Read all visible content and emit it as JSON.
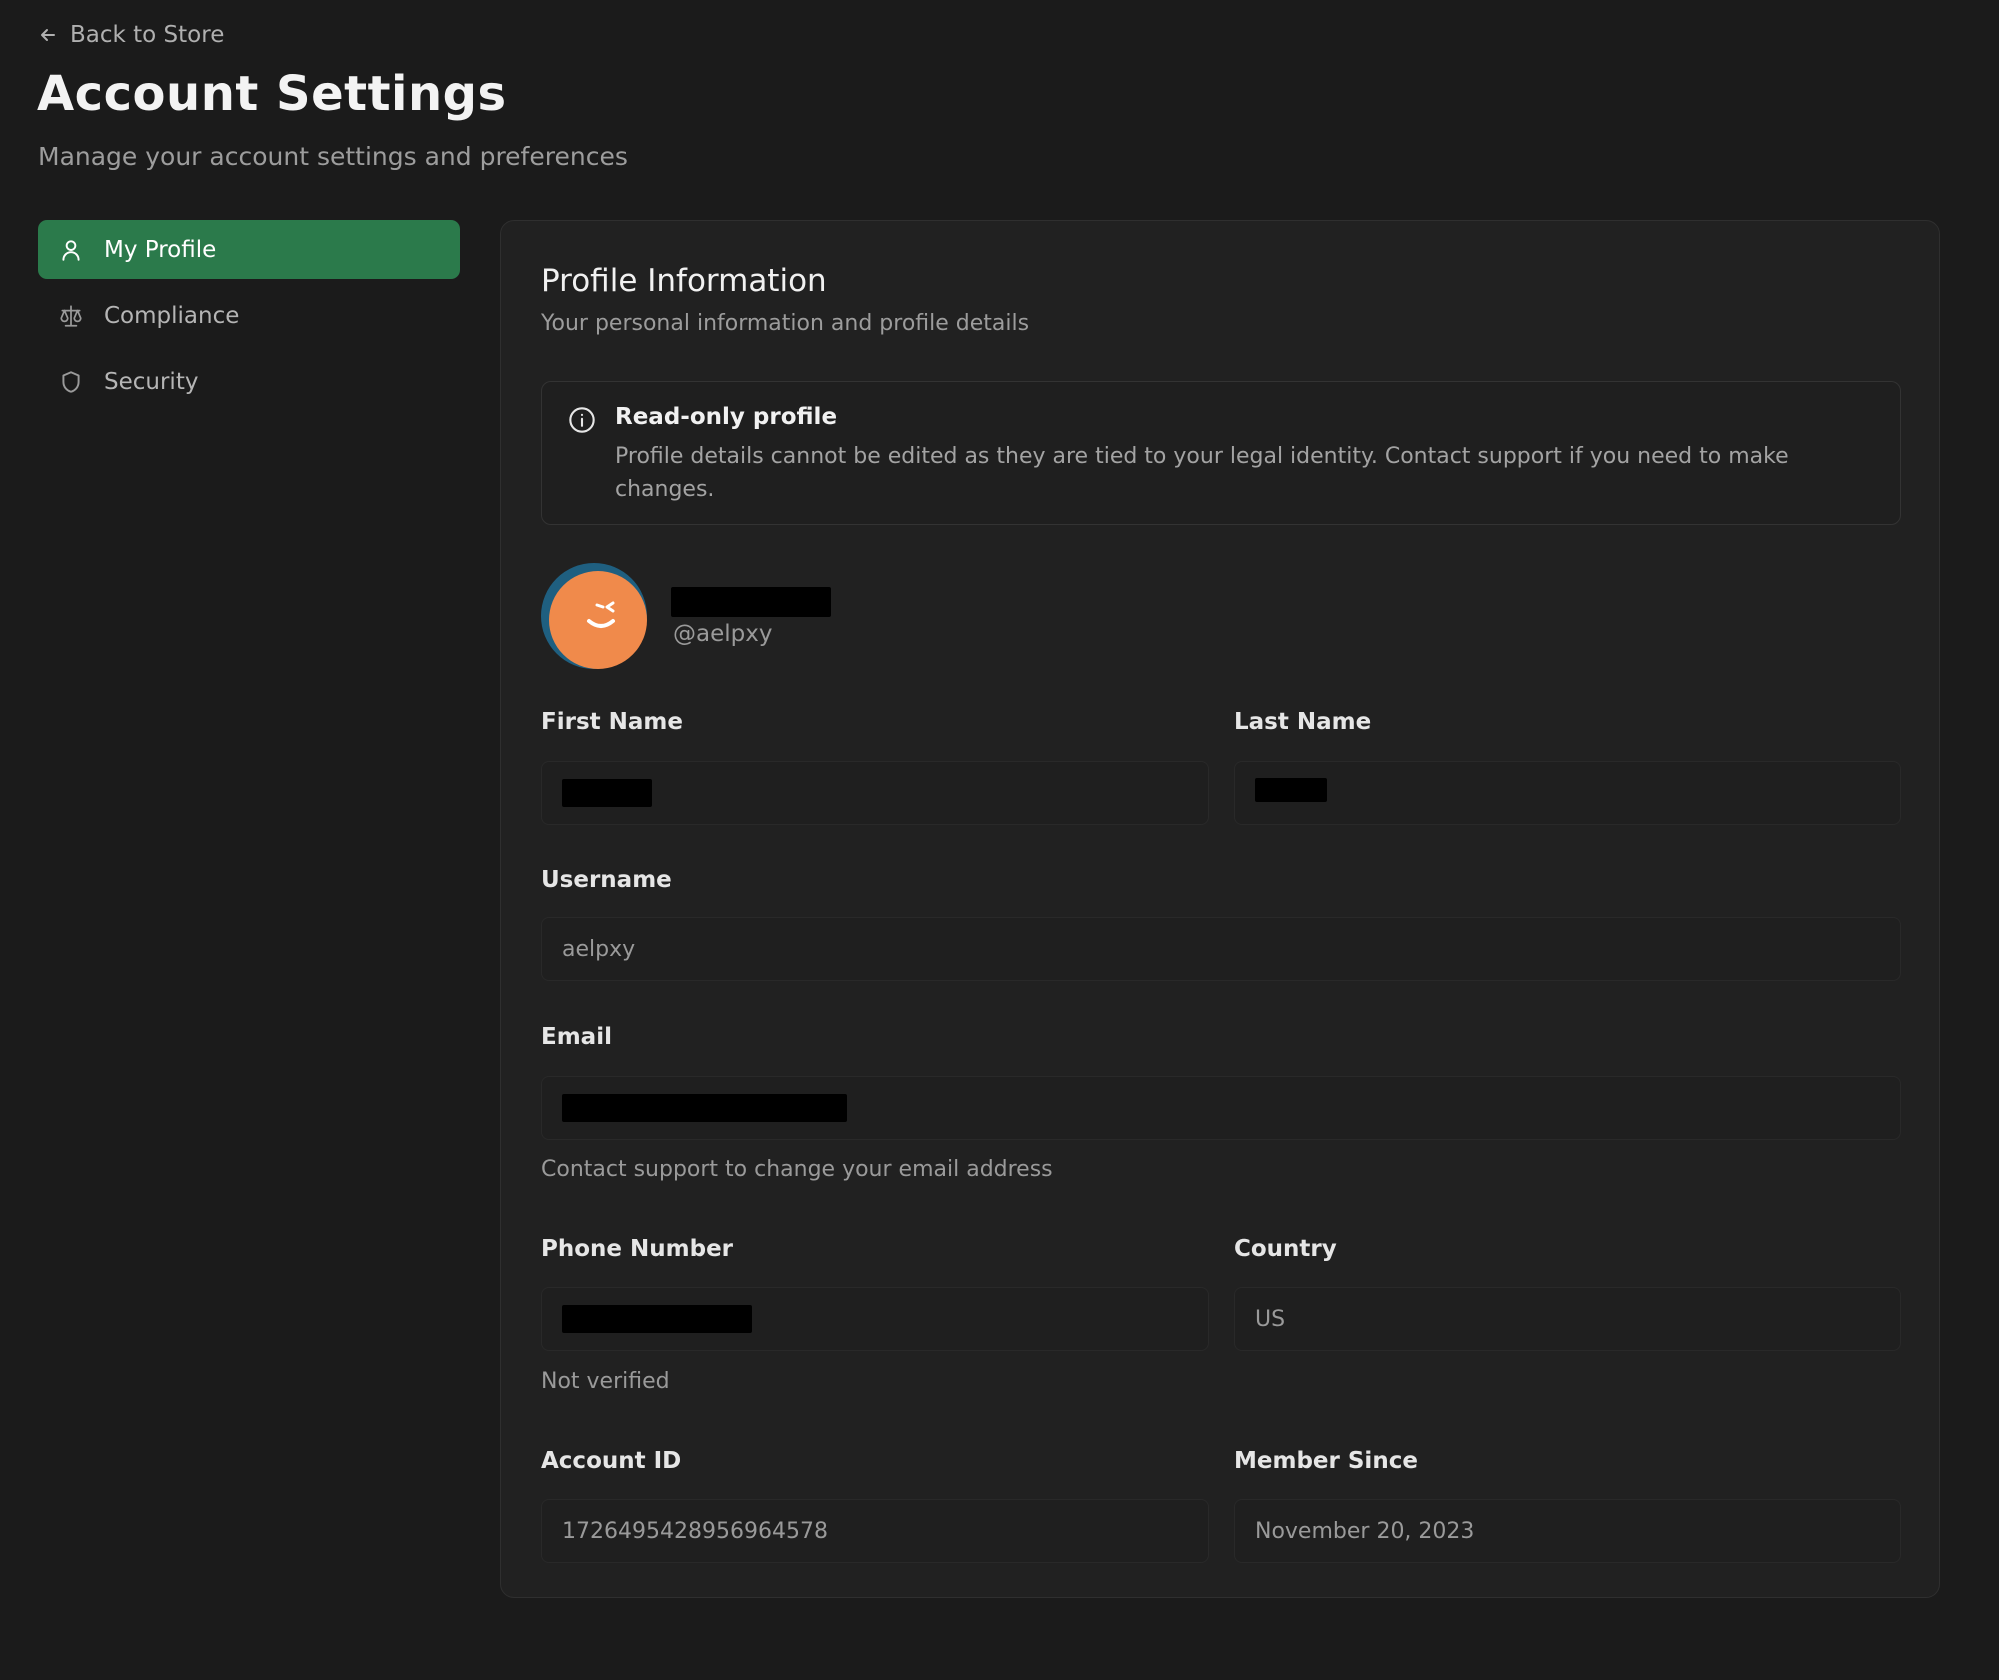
{
  "nav": {
    "back_label": "Back to Store"
  },
  "header": {
    "title": "Account Settings",
    "subtitle": "Manage your account settings and preferences"
  },
  "sidebar": {
    "items": [
      {
        "label": "My Profile",
        "icon": "user-icon",
        "active": true
      },
      {
        "label": "Compliance",
        "icon": "scale-icon",
        "active": false
      },
      {
        "label": "Security",
        "icon": "shield-icon",
        "active": false
      }
    ]
  },
  "profile": {
    "title": "Profile Information",
    "subtitle": "Your personal information and profile details",
    "notice": {
      "icon": "info-icon",
      "title": "Read-only profile",
      "text": "Profile details cannot be edited as they are tied to your legal identity. Contact support if you need to make changes."
    },
    "handle": "@aelpxy",
    "fields": {
      "first_name": {
        "label": "First Name"
      },
      "last_name": {
        "label": "Last Name"
      },
      "username": {
        "label": "Username",
        "value": "aelpxy"
      },
      "email": {
        "label": "Email",
        "hint": "Contact support to change your email address"
      },
      "phone": {
        "label": "Phone Number",
        "hint": "Not verified"
      },
      "country": {
        "label": "Country",
        "value": "US"
      },
      "account_id": {
        "label": "Account ID",
        "value": "1726495428956964578"
      },
      "member_since": {
        "label": "Member Since",
        "value": "November 20, 2023"
      }
    }
  },
  "colors": {
    "background": "#1b1b1b",
    "card": "#212121",
    "accent": "#2b7a4b",
    "avatar_orange": "#f08a4b",
    "avatar_blue": "#1f5f80"
  }
}
